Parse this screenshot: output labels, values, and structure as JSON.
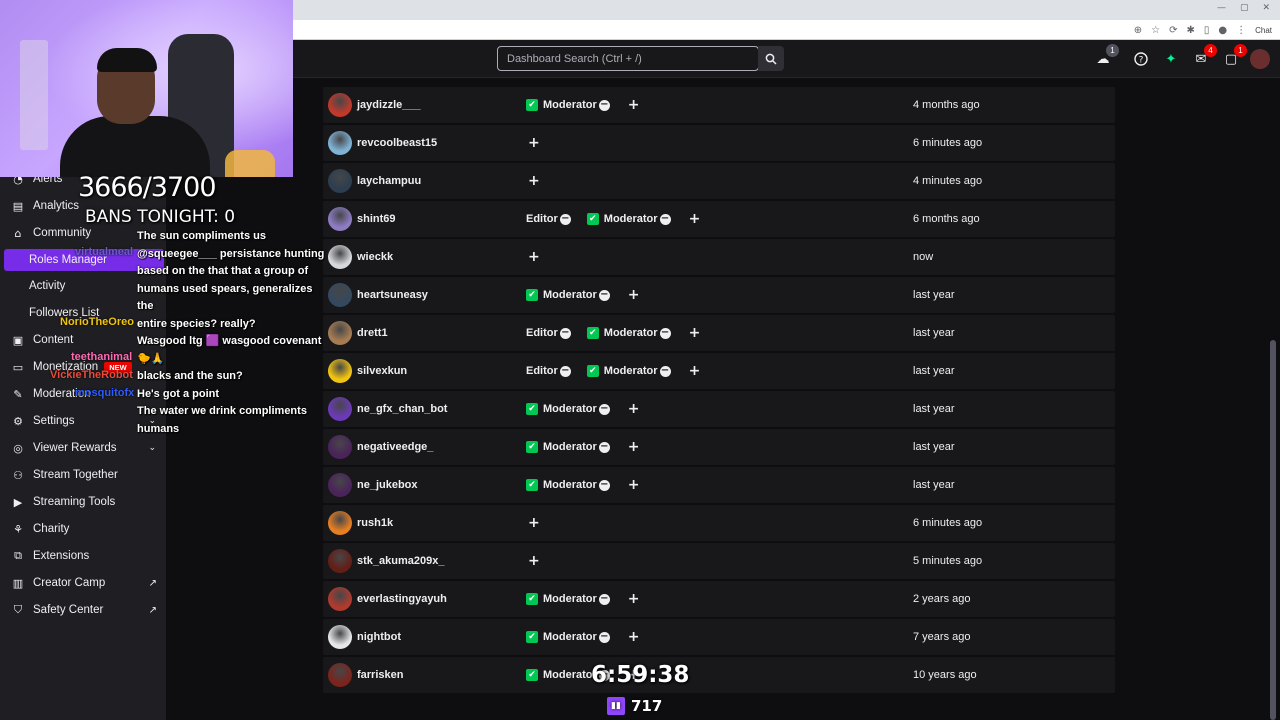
{
  "browser": {
    "chat_label": "Chat",
    "window_controls": [
      "—",
      "▢",
      "✕"
    ]
  },
  "topnav": {
    "search_placeholder": "Dashboard Search (Ctrl + /)",
    "badges": {
      "drops": "1",
      "inbox": "4",
      "whispers": "1"
    }
  },
  "overlay": {
    "counter": "3666/3700",
    "bans": "BANS TONIGHT: 0",
    "timer": "6:59:38",
    "viewers": "717"
  },
  "sidebar": {
    "items": [
      {
        "label": "Alerts",
        "icon": "alert-icon"
      },
      {
        "label": "Analytics",
        "icon": "analytics-icon"
      },
      {
        "label": "Community",
        "icon": "community-icon"
      },
      {
        "label": "Roles Manager",
        "sub": true,
        "active": true
      },
      {
        "label": "Activity",
        "sub": true
      },
      {
        "label": "Followers List",
        "sub": true
      },
      {
        "label": "Content",
        "icon": "content-icon"
      },
      {
        "label": "Monetization",
        "icon": "monetization-icon",
        "badge": "NEW"
      },
      {
        "label": "Moderation",
        "icon": "moderation-icon"
      },
      {
        "label": "Settings",
        "icon": "settings-icon"
      },
      {
        "label": "Viewer Rewards",
        "icon": "rewards-icon"
      },
      {
        "label": "Stream Together",
        "icon": "stream-together-icon"
      },
      {
        "label": "Streaming Tools",
        "icon": "streaming-tools-icon"
      },
      {
        "label": "Charity",
        "icon": "charity-icon"
      },
      {
        "label": "Extensions",
        "icon": "extensions-icon"
      },
      {
        "label": "Creator Camp",
        "icon": "creator-camp-icon"
      },
      {
        "label": "Safety Center",
        "icon": "safety-icon"
      }
    ]
  },
  "chat": {
    "names": [
      "virtualmeal",
      "NorioTheOreo",
      "teethanimal",
      "VickieTheRobot",
      "mosquitofx"
    ],
    "lines": [
      "The sun compliments us",
      "@squeegee___ persistance hunting",
      "based on the that that a group of",
      "humans used spears, generalizes the",
      "entire species? really?",
      "Wasgood ltg 🟪 wasgood covenant",
      "🐤🙏",
      "blacks and the sun?",
      "He's got a point",
      "The water we drink compliments",
      "humans"
    ]
  },
  "roles_table": {
    "rows": [
      {
        "user": "jaydizzle___",
        "roles": [
          "Moderator"
        ],
        "added": "4 months ago",
        "avatar_color": "#c0392b"
      },
      {
        "user": "revcoolbeast15",
        "roles": [],
        "added": "6 minutes ago",
        "avatar_color": "#7fb3d5"
      },
      {
        "user": "laychampuu",
        "roles": [],
        "added": "4 minutes ago",
        "avatar_color": "#2c3e50"
      },
      {
        "user": "shint69",
        "roles": [
          "Editor",
          "Moderator"
        ],
        "added": "6 months ago",
        "avatar_color": "#8e7cc3"
      },
      {
        "user": "wieckk",
        "roles": [],
        "added": "now",
        "avatar_color": "#d5d8dc"
      },
      {
        "user": "heartsuneasy",
        "roles": [
          "Moderator"
        ],
        "added": "last year",
        "avatar_color": "#34495e"
      },
      {
        "user": "drett1",
        "roles": [
          "Editor",
          "Moderator"
        ],
        "added": "last year",
        "avatar_color": "#a67c52"
      },
      {
        "user": "silvexkun",
        "roles": [
          "Editor",
          "Moderator"
        ],
        "added": "last year",
        "avatar_color": "#f1c40f"
      },
      {
        "user": "ne_gfx_chan_bot",
        "roles": [
          "Moderator"
        ],
        "added": "last year",
        "avatar_color": "#6c3ab8"
      },
      {
        "user": "negativeedge_",
        "roles": [
          "Moderator"
        ],
        "added": "last year",
        "avatar_color": "#4a235a"
      },
      {
        "user": "ne_jukebox",
        "roles": [
          "Moderator"
        ],
        "added": "last year",
        "avatar_color": "#4a235a"
      },
      {
        "user": "rush1k",
        "roles": [],
        "added": "6 minutes ago",
        "avatar_color": "#e67e22"
      },
      {
        "user": "stk_akuma209x_",
        "roles": [],
        "added": "5 minutes ago",
        "avatar_color": "#641e16"
      },
      {
        "user": "everlastingyayuh",
        "roles": [
          "Moderator"
        ],
        "added": "2 years ago",
        "avatar_color": "#b03a2e"
      },
      {
        "user": "nightbot",
        "roles": [
          "Moderator"
        ],
        "added": "7 years ago",
        "avatar_color": "#e5e8e8"
      },
      {
        "user": "farrisken",
        "roles": [
          "Moderator"
        ],
        "added": "10 years ago",
        "avatar_color": "#7b241c"
      }
    ]
  },
  "colors": {
    "accent": "#772ce8",
    "moderator_check": "#00c853",
    "badge_red": "#eb0400"
  }
}
